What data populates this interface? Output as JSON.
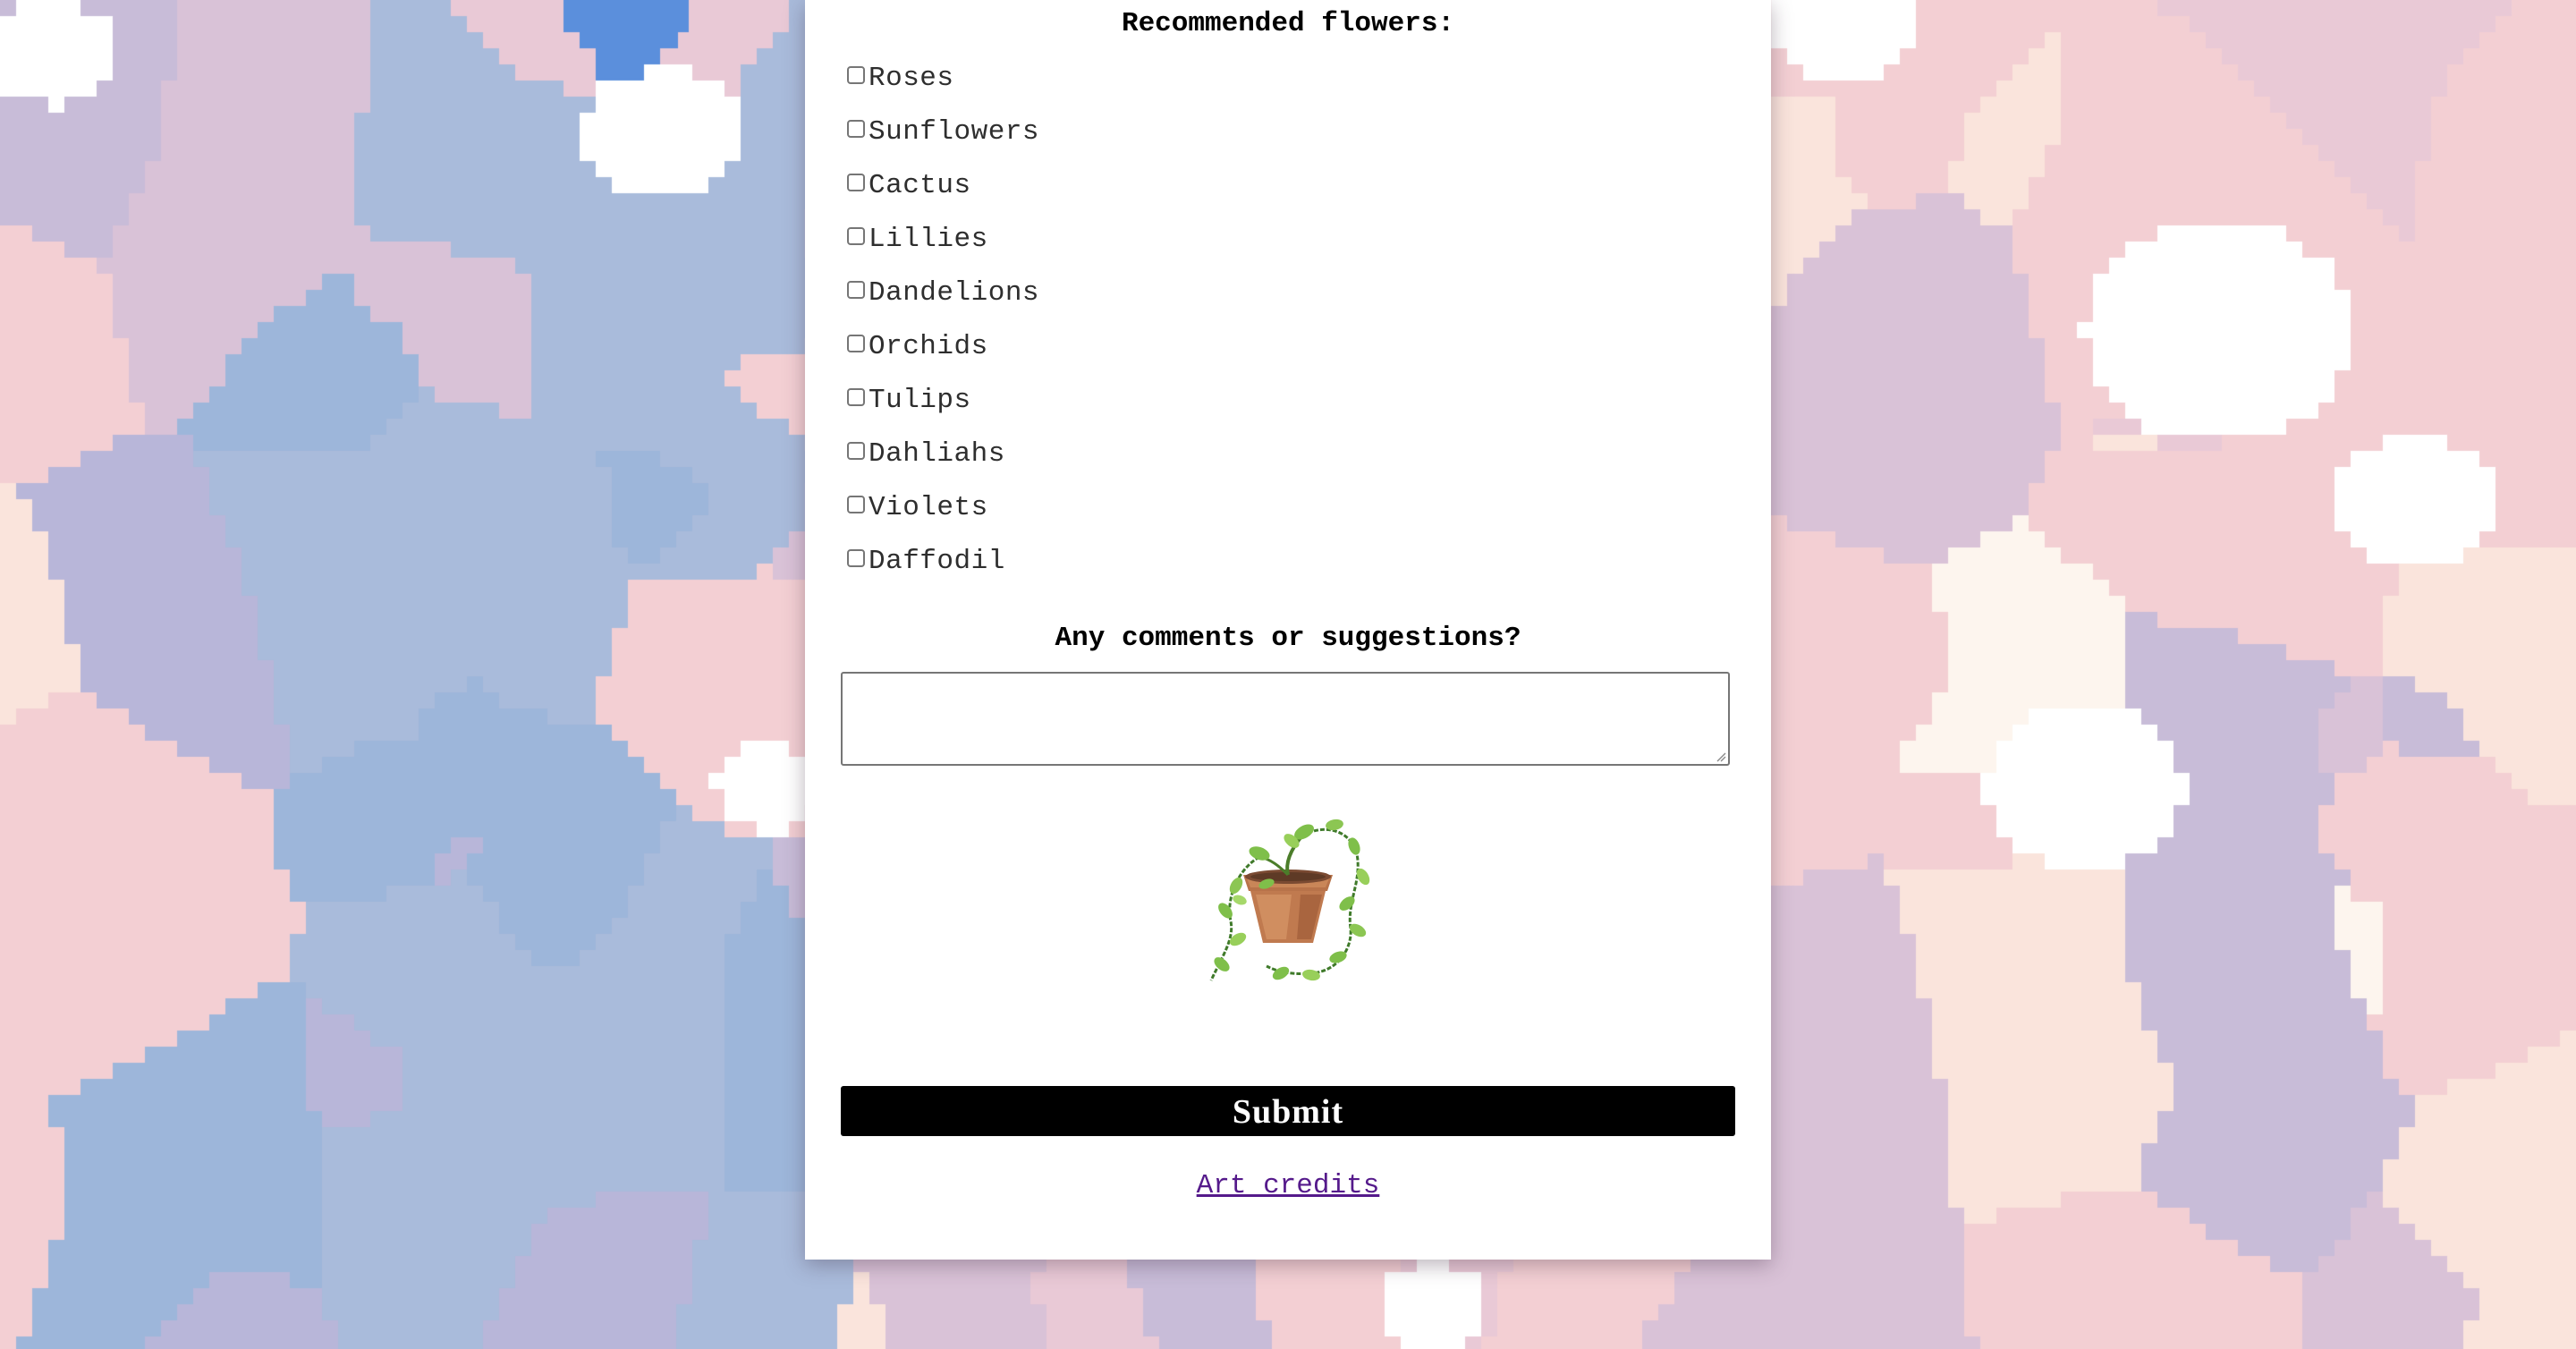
{
  "background": {
    "palette": [
      "#f3cfd3",
      "#d9c2d7",
      "#c8bcd8",
      "#a9bbdb",
      "#9db6da",
      "#fae4dc",
      "#fdf5ee",
      "#ffffff",
      "#5b8fdc",
      "#e9c9d6",
      "#b8b6d9"
    ]
  },
  "form": {
    "flowers_heading": "Recommended flowers:",
    "flowers": [
      {
        "label": "Roses",
        "checked": false
      },
      {
        "label": "Sunflowers",
        "checked": false
      },
      {
        "label": "Cactus",
        "checked": false
      },
      {
        "label": "Lillies",
        "checked": false
      },
      {
        "label": "Dandelions",
        "checked": false
      },
      {
        "label": "Orchids",
        "checked": false
      },
      {
        "label": "Tulips",
        "checked": false
      },
      {
        "label": "Dahliahs",
        "checked": false
      },
      {
        "label": "Violets",
        "checked": false
      },
      {
        "label": "Daffodil",
        "checked": false
      }
    ],
    "comments_heading": "Any comments or suggestions?",
    "comments_value": "",
    "plant_image": "potted-vine-plant-pixel-art",
    "submit_label": "Submit",
    "credits_link": "Art credits"
  },
  "colors": {
    "card": "#ffffff",
    "submit_bg": "#000000",
    "submit_text": "#ffffff",
    "link": "#551a8b",
    "label_text": "#2e2e2e"
  }
}
